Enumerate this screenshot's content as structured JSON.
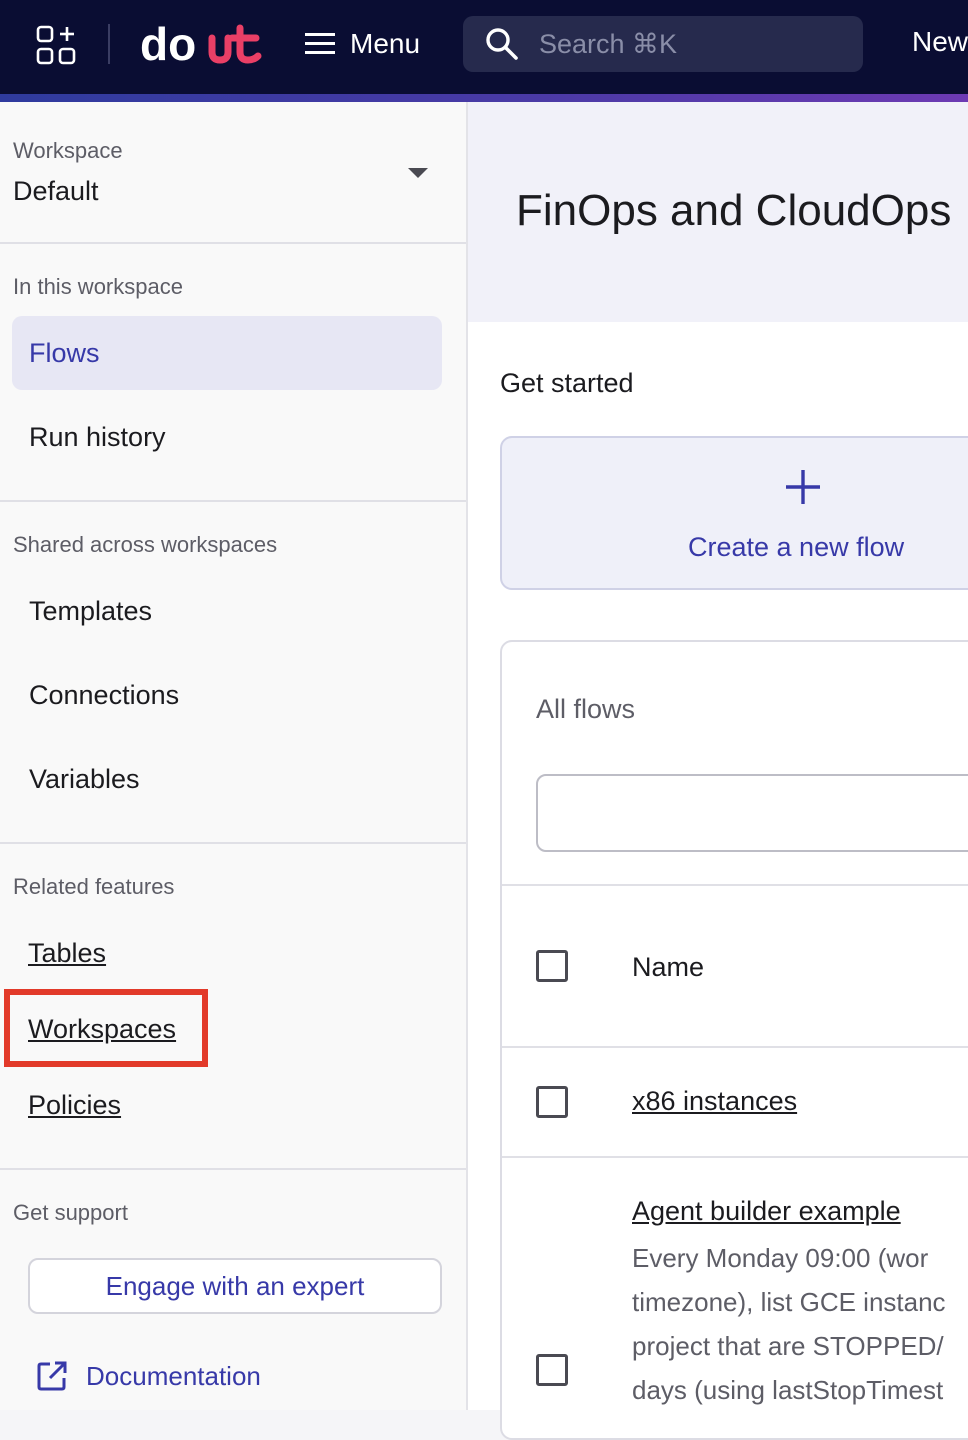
{
  "topbar": {
    "menu_label": "Menu",
    "search_placeholder": "Search ⌘K",
    "new_label": "New",
    "logo_text": "doit",
    "colors": {
      "background": "#0a0d33",
      "logo_accent": "#ea3f66"
    }
  },
  "sidebar": {
    "workspace_label": "Workspace",
    "workspace_value": "Default",
    "section_in_workspace": "In this workspace",
    "nav_flows": "Flows",
    "nav_run_history": "Run history",
    "section_shared": "Shared across workspaces",
    "nav_templates": "Templates",
    "nav_connections": "Connections",
    "nav_variables": "Variables",
    "section_related": "Related features",
    "link_tables": "Tables",
    "link_workspaces": "Workspaces",
    "link_policies": "Policies",
    "section_support": "Get support",
    "engage_button": "Engage with an expert",
    "documentation_link": "Documentation",
    "active_item": "Flows"
  },
  "main": {
    "page_title": "FinOps and CloudOps",
    "get_started": "Get started",
    "create_flow_label": "Create a new flow",
    "all_flows_title": "All flows",
    "filter_value": "",
    "table": {
      "column_name": "Name",
      "rows": [
        {
          "name": "x86 instances"
        },
        {
          "name": "Agent builder example",
          "description_lines": [
            "Every Monday 09:00 (wor",
            "timezone), list GCE instanc",
            "project that are STOPPED/",
            "days (using lastStopTimest"
          ]
        }
      ]
    }
  },
  "colors": {
    "accent": "#3739a8",
    "highlight": "#e23a2a"
  }
}
